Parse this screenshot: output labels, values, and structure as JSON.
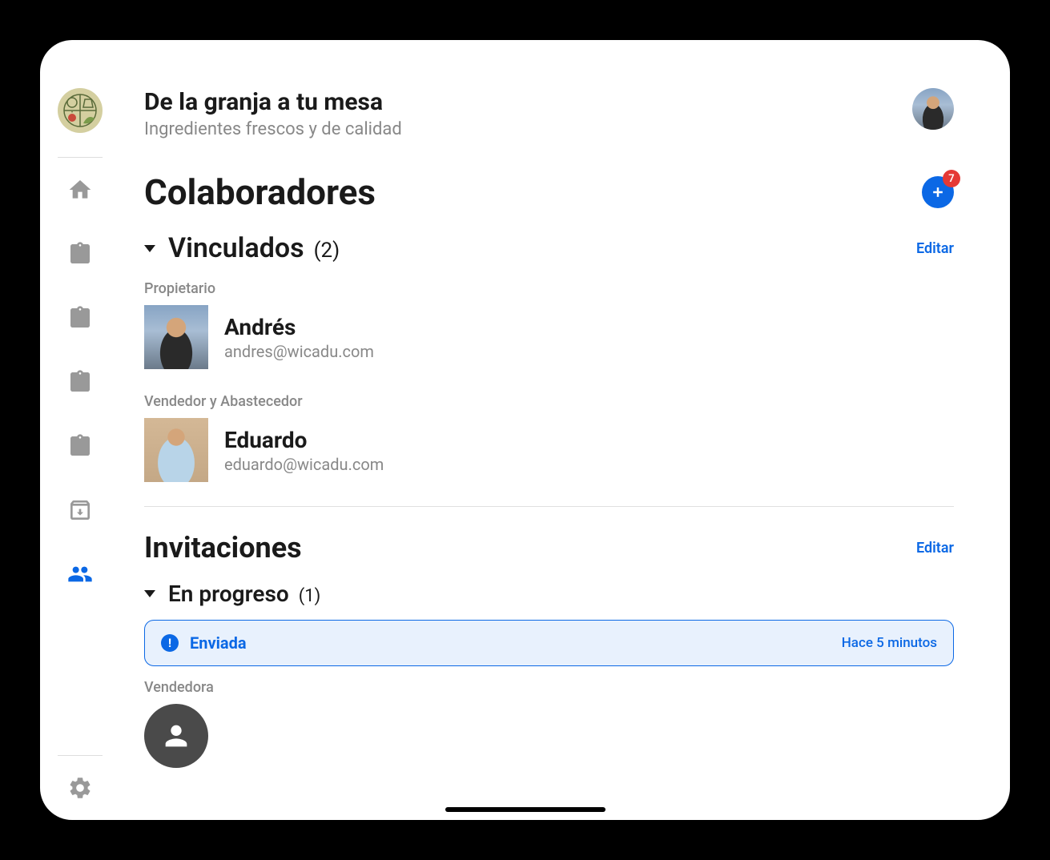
{
  "header": {
    "title": "De la granja a tu mesa",
    "subtitle": "Ingredientes frescos y de calidad"
  },
  "collaborators": {
    "title": "Colaboradores",
    "add_badge": "7",
    "linked": {
      "label": "Vinculados",
      "count": "(2)",
      "edit": "Editar"
    },
    "users": [
      {
        "role": "Propietario",
        "name": "Andrés",
        "email": "andres@wicadu.com"
      },
      {
        "role": "Vendedor y Abastecedor",
        "name": "Eduardo",
        "email": "eduardo@wicadu.com"
      }
    ]
  },
  "invitations": {
    "title": "Invitaciones",
    "edit": "Editar",
    "in_progress": {
      "label": "En progreso",
      "count": "(1)"
    },
    "status": {
      "text": "Enviada",
      "time": "Hace 5 minutos"
    },
    "pending": {
      "role": "Vendedora"
    }
  }
}
